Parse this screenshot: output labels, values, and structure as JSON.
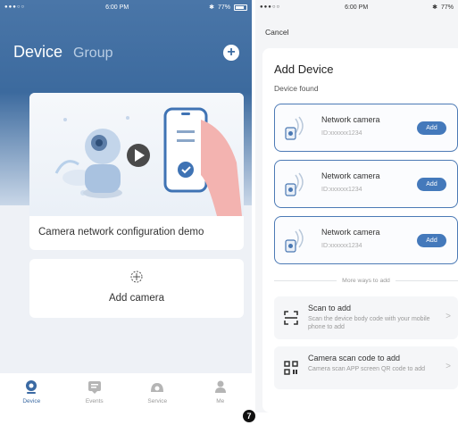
{
  "left": {
    "status": {
      "carrier": "●●●○○",
      "time": "6:00 PM",
      "battery": "77%"
    },
    "tabs": {
      "device": "Device",
      "group": "Group"
    },
    "add_symbol": "+",
    "demo_title": "Camera network configuration demo",
    "add_camera_label": "Add camera",
    "nav": [
      {
        "label": "Device",
        "icon": "device-icon",
        "active": true
      },
      {
        "label": "Events",
        "icon": "events-icon"
      },
      {
        "label": "Service",
        "icon": "service-icon"
      },
      {
        "label": "Me",
        "icon": "person-icon"
      }
    ]
  },
  "right": {
    "status": {
      "carrier": "●●●○○",
      "time": "6:00 PM",
      "battery": "77%"
    },
    "cancel": "Cancel",
    "title": "Add Device",
    "subtitle": "Device found",
    "devices": [
      {
        "name": "Network camera",
        "id": "ID:xxxxxx1234",
        "action": "Add"
      },
      {
        "name": "Network camera",
        "id": "ID:xxxxxx1234",
        "action": "Add"
      },
      {
        "name": "Network camera",
        "id": "ID:xxxxxx1234",
        "action": "Add"
      }
    ],
    "more_ways": "More ways to add",
    "options": [
      {
        "title": "Scan to add",
        "desc": "Scan the device body code with your mobile phone to add",
        "icon": "scan-icon"
      },
      {
        "title": "Camera scan code to add",
        "desc": "Camera scan APP screen QR code to add",
        "icon": "qr-code-icon"
      }
    ]
  },
  "step_number": "7",
  "colors": {
    "accent": "#4479bb",
    "header_top": "#4a76a8"
  }
}
